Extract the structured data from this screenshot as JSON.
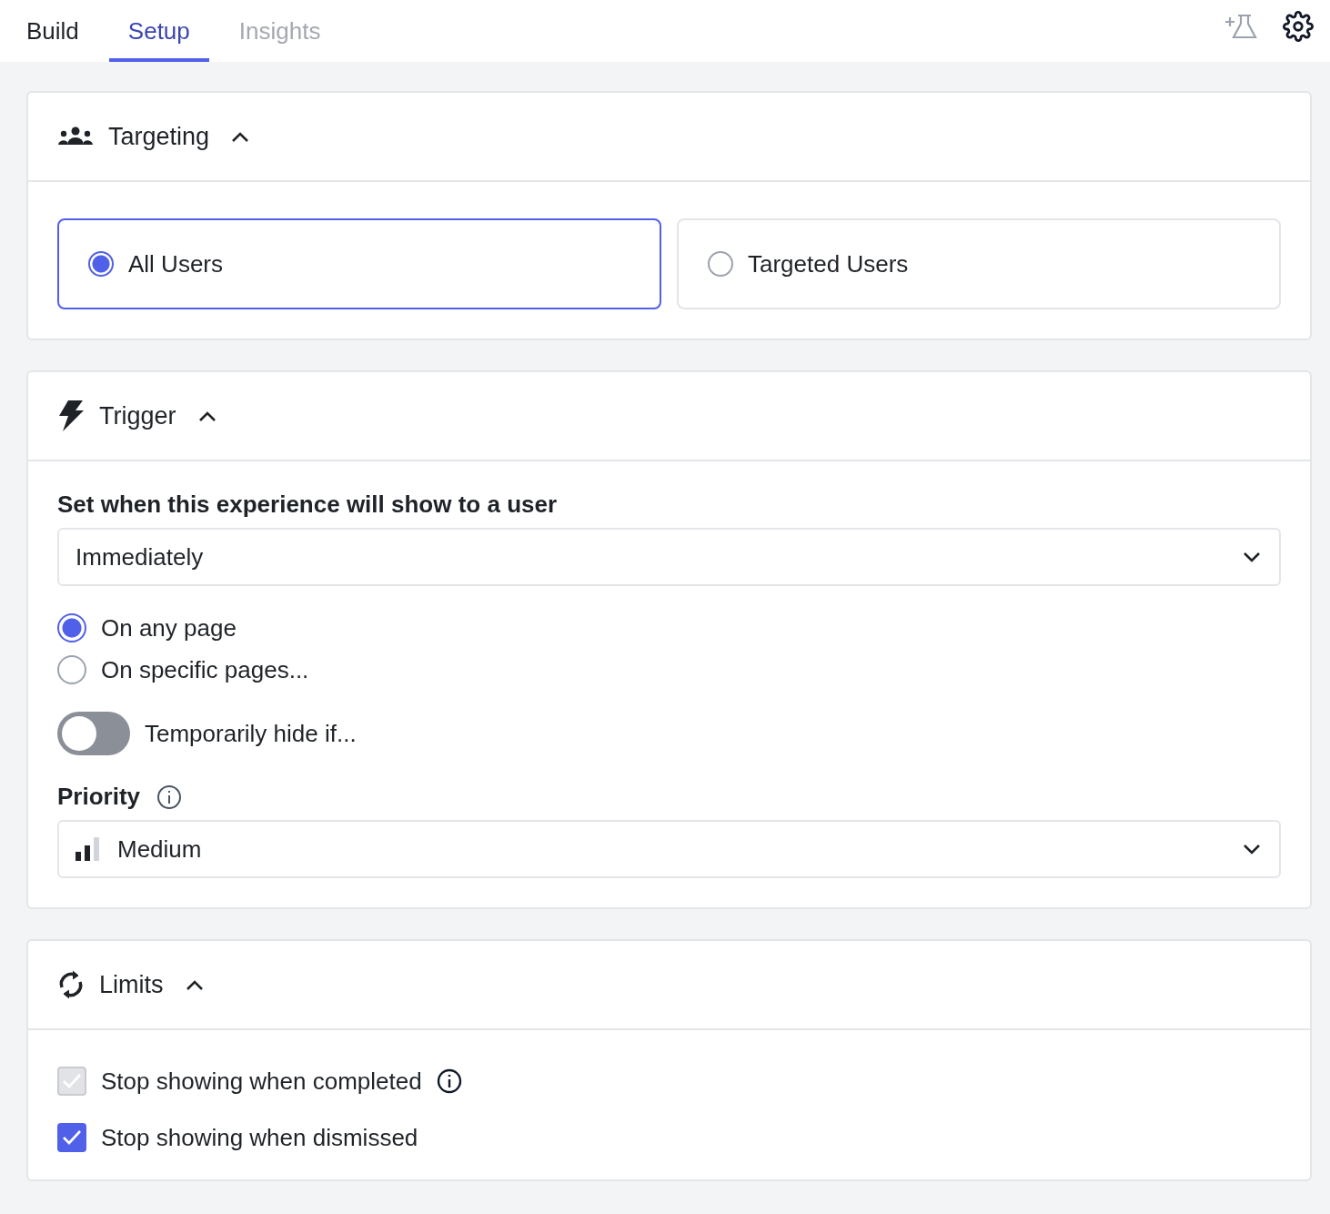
{
  "tabs": [
    {
      "label": "Build",
      "selected": false,
      "disabled": false
    },
    {
      "label": "Setup",
      "selected": true,
      "disabled": false
    },
    {
      "label": "Insights",
      "selected": false,
      "disabled": true
    }
  ],
  "targeting": {
    "title": "Targeting",
    "expanded": true,
    "options": [
      {
        "label": "All Users",
        "selected": true
      },
      {
        "label": "Targeted Users",
        "selected": false
      }
    ]
  },
  "trigger": {
    "title": "Trigger",
    "expanded": true,
    "label": "Set when this experience will show to a user",
    "timing": {
      "value": "Immediately"
    },
    "pages": [
      {
        "label": "On any page",
        "selected": true
      },
      {
        "label": "On specific pages...",
        "selected": false
      }
    ],
    "hide_toggle": {
      "label": "Temporarily hide if...",
      "on": false
    },
    "priority": {
      "label": "Priority",
      "value": "Medium"
    }
  },
  "limits": {
    "title": "Limits",
    "expanded": true,
    "options": [
      {
        "label": "Stop showing when completed",
        "checked": true,
        "disabled": true,
        "info": true
      },
      {
        "label": "Stop showing when dismissed",
        "checked": true,
        "disabled": false,
        "info": false
      }
    ]
  }
}
